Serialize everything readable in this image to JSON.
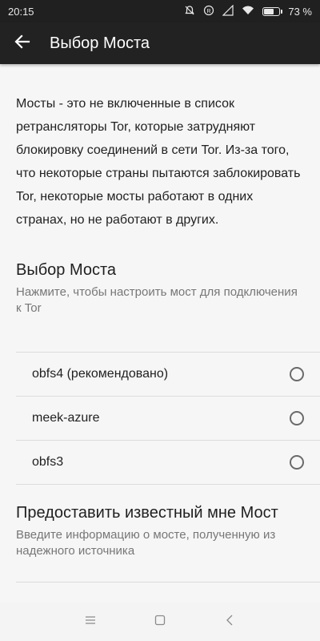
{
  "status_bar": {
    "time": "20:15",
    "battery_text": "73 %",
    "battery_level": 0.73
  },
  "app_bar": {
    "title": "Выбор Моста",
    "back_icon": "arrow-left-icon"
  },
  "description": "Мосты - это не включенные в список ретрансляторы Tor, которые затрудняют блокировку соединений в сети Tor. Из-за того, что некоторые страны пытаются заблокировать Tor, некоторые мосты работают в одних странах, но не работают в других.",
  "bridge_choice": {
    "title": "Выбор Моста",
    "subtitle": "Нажмите, чтобы настроить мост для подключения к Tor",
    "options": [
      {
        "label": "obfs4 (рекомендовано)",
        "selected": false
      },
      {
        "label": "meek-azure",
        "selected": false
      },
      {
        "label": "obfs3",
        "selected": false
      }
    ]
  },
  "known_bridge": {
    "title": "Предоставить известный мне Мост",
    "subtitle": "Введите информацию о мосте, полученную из надежного источника"
  },
  "nav_bar": {
    "icons": [
      "menu-icon",
      "home-square-icon",
      "back-chevron-icon"
    ]
  }
}
